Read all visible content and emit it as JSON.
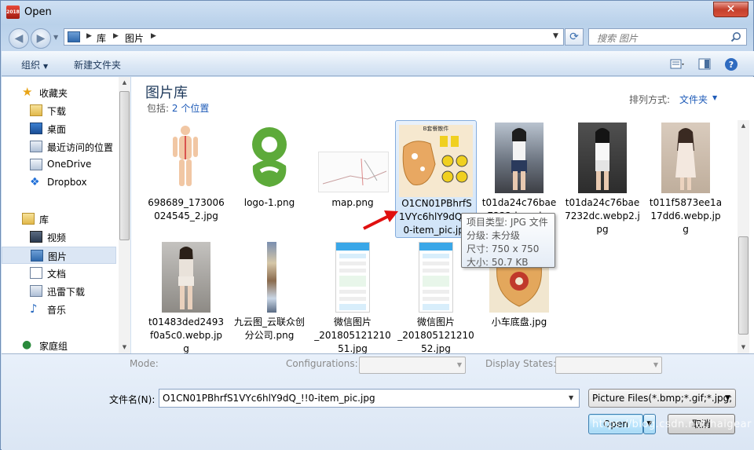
{
  "window": {
    "title": "Open",
    "app_icon_text": "2018"
  },
  "address": {
    "crumbs": [
      "库",
      "图片"
    ]
  },
  "search": {
    "placeholder": "搜索 图片"
  },
  "toolbar": {
    "organize": "组织",
    "new_folder": "新建文件夹"
  },
  "nav": {
    "favorites": {
      "label": "收藏夹",
      "items": [
        "下载",
        "桌面",
        "最近访问的位置",
        "OneDrive",
        "Dropbox"
      ]
    },
    "libraries": {
      "label": "库",
      "items": [
        "视频",
        "图片",
        "文档",
        "迅雷下载",
        "音乐"
      ],
      "selected": "图片"
    },
    "homegroup": {
      "label": "家庭组"
    }
  },
  "library": {
    "title": "图片库",
    "includes_label": "包括:",
    "includes_value": "2 个位置",
    "arrange_label": "排列方式:",
    "arrange_value": "文件夹"
  },
  "files": [
    {
      "name": "698689_173006024545_2.jpg",
      "thumb": "anatomy"
    },
    {
      "name": "logo-1.png",
      "thumb": "green-logo"
    },
    {
      "name": "map.png",
      "thumb": "map"
    },
    {
      "name": "O1CN01PBhrfS1VYc6hlY9dQ_!!0-item_pic.jpg",
      "thumb": "robot-kit",
      "selected": true
    },
    {
      "name": "t01da24c76bae7232dc.webp",
      "thumb": "photo-dark"
    },
    {
      "name": "t01da24c76bae7232dc.webp2.jpg",
      "thumb": "photo-light"
    },
    {
      "name": "t011f5873ee1a17dd6.webp.jpg",
      "thumb": "photo-pink"
    },
    {
      "name": "t01483ded2493f0a5c0.webp.jpg",
      "thumb": "photo-street"
    },
    {
      "name": "九云图_云联众创分公司.png",
      "thumb": "vertical-strip"
    },
    {
      "name": "微信图片_2018051212105 1.jpg",
      "thumb": "phone-screen"
    },
    {
      "name": "微信图片_2018051212105 2.jpg",
      "thumb": "phone-screen"
    },
    {
      "name": "小车底盘.jpg",
      "thumb": "car-chassis"
    }
  ],
  "file_labels": [
    [
      "698689_173006",
      "024545_2.jpg"
    ],
    [
      "logo-1.png"
    ],
    [
      "map.png"
    ],
    [
      "O1CN01PBhrfS",
      "1VYc6hlY9dQ_!!",
      "0-item_pic.jpg"
    ],
    [
      "t01da24c76bae",
      "7232dc.webp"
    ],
    [
      "t01da24c76bae",
      "7232dc.webp2.j",
      "pg"
    ],
    [
      "t011f5873ee1a",
      "17dd6.webp.jp",
      "g"
    ],
    [
      "t01483ded2493",
      "f0a5c0.webp.jp",
      "g"
    ],
    [
      "九云图_云联众创",
      "分公司.png"
    ],
    [
      "微信图片",
      "_201805121210",
      "51.jpg"
    ],
    [
      "微信图片",
      "_201805121210",
      "52.jpg"
    ],
    [
      "小车底盘.jpg"
    ]
  ],
  "thumb_caption": "B套餐散件",
  "tooltip": {
    "type": "项目类型: JPG 文件",
    "rating": "分级: 未分级",
    "size": "尺寸: 750 x 750",
    "filesize": "大小: 50.7 KB"
  },
  "bottom": {
    "mode_label": "Mode:",
    "configurations_label": "Configurations:",
    "display_states_label": "Display States:",
    "filename_label": "文件名(N):",
    "filename_value": "O1CN01PBhrfS1VYc6hlY9dQ_!!0-item_pic.jpg",
    "filter_value": "Picture Files(*.bmp;*.gif;*.jpg;",
    "open_label": "Open",
    "cancel_label": "取消",
    "watermark": "https://blog.csdn.net/haigear"
  },
  "colors": {
    "accent": "#1e5bb8",
    "selection": "#cfe3f8",
    "arrow": "#e01010"
  }
}
